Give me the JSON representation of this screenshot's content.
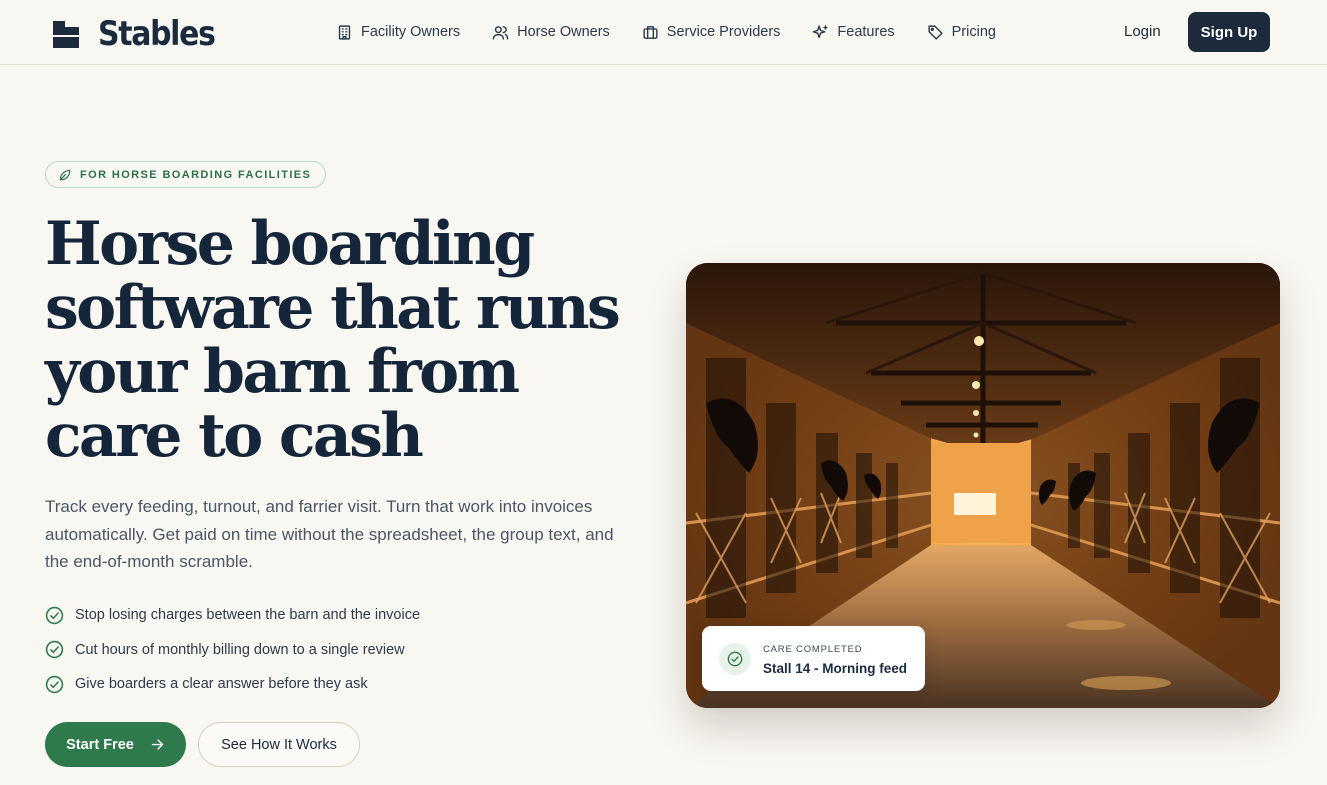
{
  "brand": {
    "name": "Stables"
  },
  "nav": {
    "items": [
      {
        "label": "Facility Owners",
        "icon": "building-icon"
      },
      {
        "label": "Horse Owners",
        "icon": "users-icon"
      },
      {
        "label": "Service Providers",
        "icon": "briefcase-icon"
      },
      {
        "label": "Features",
        "icon": "sparkles-icon"
      },
      {
        "label": "Pricing",
        "icon": "tag-icon"
      }
    ],
    "login": "Login",
    "signup": "Sign Up"
  },
  "hero": {
    "badge": "FOR HORSE BOARDING FACILITIES",
    "headline": "Horse boarding software that runs your barn from care to cash",
    "subheadline": "Track every feeding, turnout, and farrier visit. Turn that work into invoices automatically. Get paid on time without the spreadsheet, the group text, and the end-of-month scramble.",
    "checks": [
      "Stop losing charges between the barn and the invoice",
      "Cut hours of monthly billing down to a single review",
      "Give boarders a clear answer before they ask"
    ],
    "cta_primary": "Start Free",
    "cta_secondary": "See How It Works"
  },
  "care_card": {
    "label": "CARE COMPLETED",
    "title": "Stall 14 - Morning feed"
  },
  "colors": {
    "background": "#f9f7f1",
    "navy": "#1c2a3b",
    "green": "#2f7a4d"
  }
}
